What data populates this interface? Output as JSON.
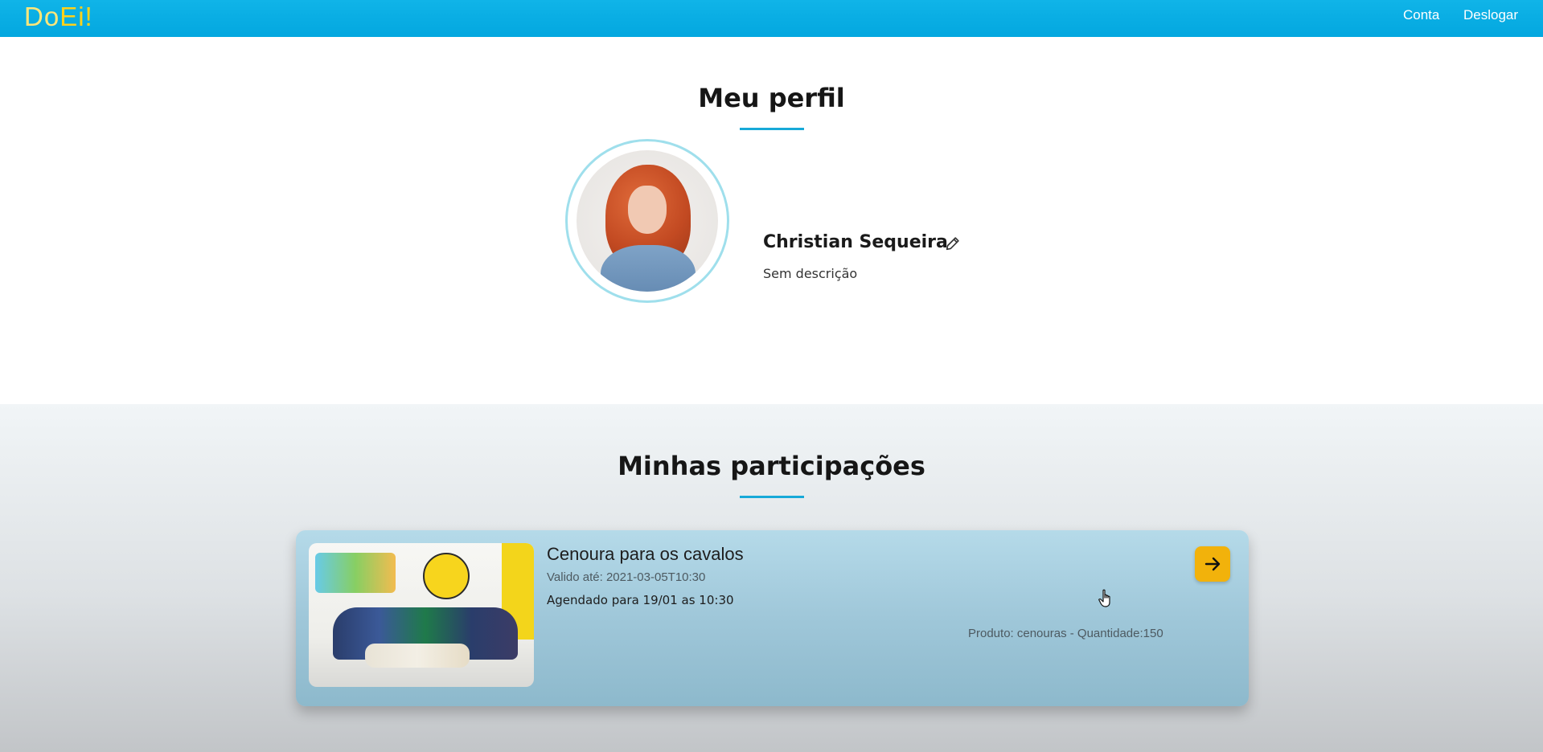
{
  "header": {
    "logo_do": "Do",
    "logo_ei": "Ei!",
    "nav": [
      "Conta",
      "Deslogar"
    ]
  },
  "profile": {
    "title": "Meu perfil",
    "name": "Christian Sequeira",
    "description": "Sem descrição",
    "icons": {
      "edit": "pencil-icon"
    }
  },
  "participations": {
    "title": "Minhas participações",
    "items": [
      {
        "title": "Cenoura para os cavalos",
        "valid_until": "Valido até: 2021-03-05T10:30",
        "scheduled": "Agendado para 19/01 as 10:30",
        "product": "Produto: cenouras - Quantidade:150",
        "icon": "arrow-right-icon"
      }
    ]
  },
  "colors": {
    "brand_blue": "#03a7df",
    "accent_yellow": "#f2b20b",
    "underline": "#17a9d8"
  }
}
